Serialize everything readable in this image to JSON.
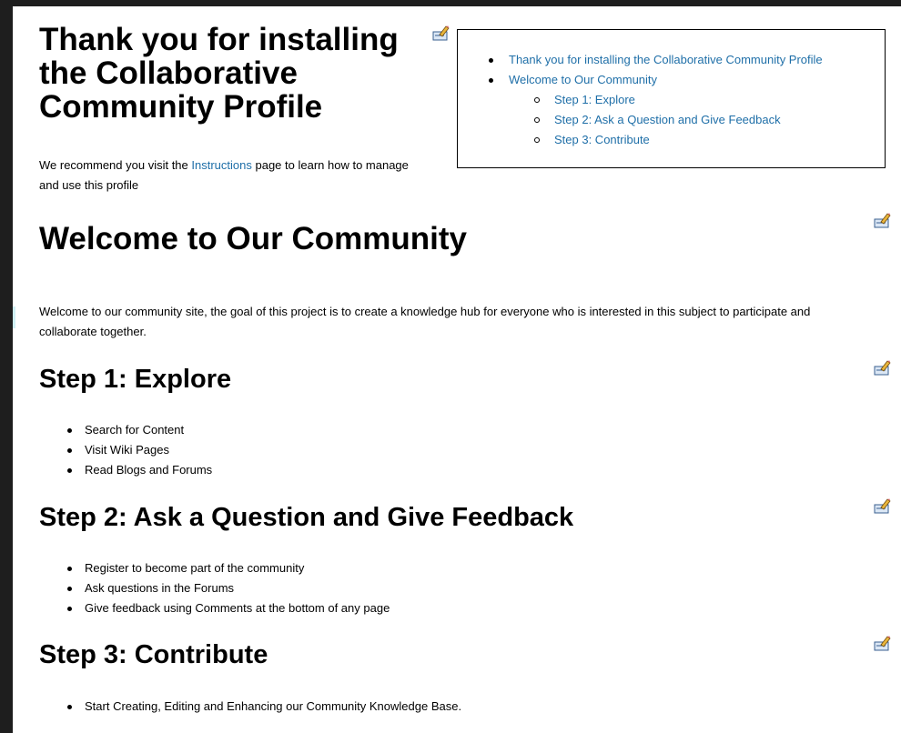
{
  "header": {
    "title": "Thank you for installing the Collaborative Community Profile",
    "intro_pre": "We recommend you visit the ",
    "intro_link": "Instructions",
    "intro_post": " page to learn how to manage and use this profile"
  },
  "toc": {
    "items": [
      "Thank you for installing the Collaborative Community Profile",
      "Welcome to Our Community",
      "Step 1: Explore",
      "Step 2: Ask a Question and Give Feedback",
      "Step 3: Contribute"
    ]
  },
  "welcome": {
    "title": "Welcome to Our Community",
    "text": "Welcome to our community site, the goal of this project is to create a knowledge hub for everyone who is interested in this subject to participate and collaborate together."
  },
  "step1": {
    "title": "Step 1: Explore",
    "items": [
      "Search for Content",
      "Visit Wiki Pages",
      "Read Blogs and Forums"
    ]
  },
  "step2": {
    "title": "Step 2: Ask a Question and Give Feedback",
    "items": [
      "Register to become part of the community",
      "Ask questions in the Forums",
      "Give feedback using Comments at the bottom of any page"
    ]
  },
  "step3": {
    "title": "Step 3: Contribute",
    "items": [
      "Start Creating, Editing and Enhancing our Community Knowledge Base."
    ]
  },
  "icons": {
    "edit": "edit-pencil-icon"
  },
  "colors": {
    "link": "#1f6fa8",
    "background": "#ffffff",
    "frame": "#1e1e1e"
  }
}
